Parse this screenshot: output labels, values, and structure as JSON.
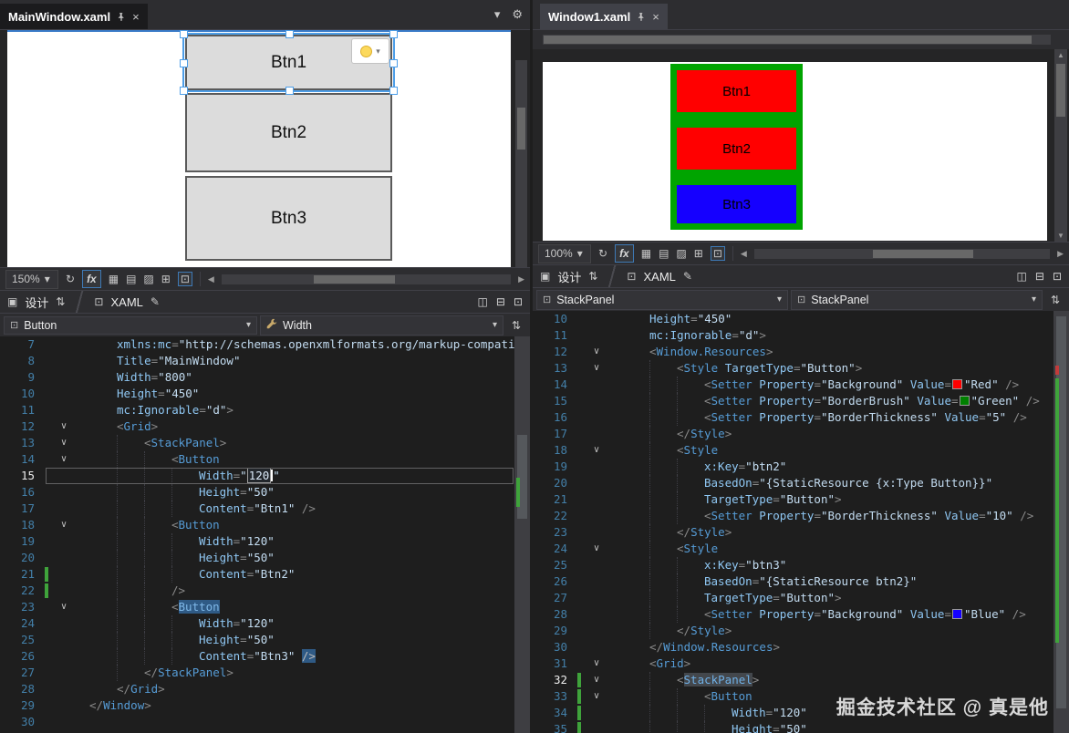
{
  "watermark": "掘金技术社区 @ 真是他",
  "icons": {
    "close": "×",
    "chevron": "▾",
    "gear": "⚙",
    "refresh": "↻",
    "left": "◀",
    "right": "▶",
    "up": "▲",
    "down": "▼",
    "swap": "⇅",
    "grid": "▦",
    "grid2": "▤",
    "snap": "▨",
    "guides": "⊞",
    "dock": "⊡",
    "design": "▣",
    "xamlsq": "⊡",
    "edit": "✎",
    "splitv": "◫",
    "splith": "⊟",
    "popout": "⊞"
  },
  "left": {
    "tab": "MainWindow.xaml",
    "zoom": "150%",
    "fx": "fx",
    "design_label": "设计",
    "xaml_label": "XAML",
    "crumb_element": "Button",
    "crumb_property": "Width",
    "designer_buttons": [
      {
        "label": "Btn1",
        "selected": true
      },
      {
        "label": "Btn2",
        "selected": false
      },
      {
        "label": "Btn3",
        "selected": false
      }
    ],
    "lines": [
      {
        "n": 7,
        "i": 4,
        "t": [
          [
            "a",
            "xmlns:mc"
          ],
          [
            "p",
            "="
          ],
          [
            "v",
            "\"http://schemas.openxmlformats.org/markup-compati"
          ]
        ]
      },
      {
        "n": 8,
        "i": 4,
        "t": [
          [
            "a",
            "Title"
          ],
          [
            "p",
            "="
          ],
          [
            "v",
            "\"MainWindow\""
          ]
        ]
      },
      {
        "n": 9,
        "i": 4,
        "t": [
          [
            "a",
            "Width"
          ],
          [
            "p",
            "="
          ],
          [
            "v",
            "\"800\""
          ]
        ]
      },
      {
        "n": 10,
        "i": 4,
        "t": [
          [
            "a",
            "Height"
          ],
          [
            "p",
            "="
          ],
          [
            "v",
            "\"450\""
          ]
        ]
      },
      {
        "n": 11,
        "i": 4,
        "t": [
          [
            "a",
            "mc:Ignorable"
          ],
          [
            "p",
            "="
          ],
          [
            "v",
            "\"d\""
          ],
          [
            "p",
            ">"
          ]
        ]
      },
      {
        "n": 12,
        "i": 4,
        "a": 1,
        "t": [
          [
            "p",
            "<"
          ],
          [
            "e",
            "Grid"
          ],
          [
            "p",
            ">"
          ]
        ]
      },
      {
        "n": 13,
        "i": 8,
        "a": 1,
        "t": [
          [
            "p",
            "<"
          ],
          [
            "e",
            "StackPanel"
          ],
          [
            "p",
            ">"
          ]
        ]
      },
      {
        "n": 14,
        "i": 12,
        "a": 1,
        "t": [
          [
            "p",
            "<"
          ],
          [
            "e",
            "Button"
          ]
        ]
      },
      {
        "n": 15,
        "i": 16,
        "cur": 1,
        "w": 1,
        "t": [
          [
            "a",
            "Width"
          ],
          [
            "p",
            "="
          ],
          [
            "v",
            "\""
          ],
          [
            "vs",
            "120"
          ],
          [
            "cr",
            ""
          ],
          [
            "v",
            "\""
          ]
        ]
      },
      {
        "n": 16,
        "i": 16,
        "t": [
          [
            "a",
            "Height"
          ],
          [
            "p",
            "="
          ],
          [
            "v",
            "\"50\""
          ]
        ]
      },
      {
        "n": 17,
        "i": 16,
        "t": [
          [
            "a",
            "Content"
          ],
          [
            "p",
            "="
          ],
          [
            "v",
            "\"Btn1\""
          ],
          [
            "p",
            " />"
          ]
        ]
      },
      {
        "n": 18,
        "i": 12,
        "a": 1,
        "t": [
          [
            "p",
            "<"
          ],
          [
            "e",
            "Button"
          ]
        ]
      },
      {
        "n": 19,
        "i": 16,
        "t": [
          [
            "a",
            "Width"
          ],
          [
            "p",
            "="
          ],
          [
            "v",
            "\"120\""
          ]
        ]
      },
      {
        "n": 20,
        "i": 16,
        "t": [
          [
            "a",
            "Height"
          ],
          [
            "p",
            "="
          ],
          [
            "v",
            "\"50\""
          ]
        ]
      },
      {
        "n": 21,
        "i": 16,
        "g": 1,
        "t": [
          [
            "a",
            "Content"
          ],
          [
            "p",
            "="
          ],
          [
            "v",
            "\"Btn2\""
          ]
        ]
      },
      {
        "n": 22,
        "i": 12,
        "g": 1,
        "t": [
          [
            "p",
            "/>"
          ]
        ]
      },
      {
        "n": 23,
        "i": 12,
        "a": 1,
        "t": [
          [
            "p",
            "<"
          ],
          [
            "eh",
            "Button"
          ]
        ]
      },
      {
        "n": 24,
        "i": 16,
        "t": [
          [
            "a",
            "Width"
          ],
          [
            "p",
            "="
          ],
          [
            "v",
            "\"120\""
          ]
        ]
      },
      {
        "n": 25,
        "i": 16,
        "t": [
          [
            "a",
            "Height"
          ],
          [
            "p",
            "="
          ],
          [
            "v",
            "\"50\""
          ]
        ]
      },
      {
        "n": 26,
        "i": 16,
        "t": [
          [
            "a",
            "Content"
          ],
          [
            "p",
            "="
          ],
          [
            "v",
            "\"Btn3\""
          ],
          [
            "p",
            " "
          ],
          [
            "ph",
            "/>"
          ]
        ]
      },
      {
        "n": 27,
        "i": 8,
        "t": [
          [
            "p",
            "</"
          ],
          [
            "e",
            "StackPanel"
          ],
          [
            "p",
            ">"
          ]
        ]
      },
      {
        "n": 28,
        "i": 4,
        "t": [
          [
            "p",
            "</"
          ],
          [
            "e",
            "Grid"
          ],
          [
            "p",
            ">"
          ]
        ]
      },
      {
        "n": 29,
        "i": 0,
        "t": [
          [
            "p",
            "</"
          ],
          [
            "e",
            "Window"
          ],
          [
            "p",
            ">"
          ]
        ]
      },
      {
        "n": 30,
        "i": 0,
        "t": []
      }
    ]
  },
  "right": {
    "tab": "Window1.xaml",
    "zoom": "100%",
    "fx": "fx",
    "design_label": "设计",
    "xaml_label": "XAML",
    "crumb_element": "StackPanel",
    "crumb_element2": "StackPanel",
    "panel": {
      "bg": "#00A400",
      "buttons": [
        {
          "label": "Btn1",
          "bg": "#FF0000"
        },
        {
          "label": "Btn2",
          "bg": "#FF0000"
        },
        {
          "label": "Btn3",
          "bg": "#1500FF"
        }
      ]
    },
    "lines": [
      {
        "n": 10,
        "i": 4,
        "t": [
          [
            "a",
            "Height"
          ],
          [
            "p",
            "="
          ],
          [
            "v",
            "\"450\""
          ]
        ]
      },
      {
        "n": 11,
        "i": 4,
        "t": [
          [
            "a",
            "mc:Ignorable"
          ],
          [
            "p",
            "="
          ],
          [
            "v",
            "\"d\""
          ],
          [
            "p",
            ">"
          ]
        ]
      },
      {
        "n": 12,
        "i": 4,
        "a": 1,
        "t": [
          [
            "p",
            "<"
          ],
          [
            "e",
            "Window.Resources"
          ],
          [
            "p",
            ">"
          ]
        ]
      },
      {
        "n": 13,
        "i": 8,
        "a": 1,
        "t": [
          [
            "p",
            "<"
          ],
          [
            "e",
            "Style"
          ],
          [
            "p",
            " "
          ],
          [
            "a",
            "TargetType"
          ],
          [
            "p",
            "="
          ],
          [
            "v",
            "\"Button\""
          ],
          [
            "p",
            ">"
          ]
        ]
      },
      {
        "n": 14,
        "i": 12,
        "t": [
          [
            "p",
            "<"
          ],
          [
            "e",
            "Setter"
          ],
          [
            "p",
            " "
          ],
          [
            "a",
            "Property"
          ],
          [
            "p",
            "="
          ],
          [
            "v",
            "\"Background\""
          ],
          [
            "p",
            " "
          ],
          [
            "a",
            "Value"
          ],
          [
            "p",
            "="
          ],
          [
            "sw",
            "#FF0000"
          ],
          [
            "v",
            "\"Red\""
          ],
          [
            "p",
            " />"
          ]
        ]
      },
      {
        "n": 15,
        "i": 12,
        "t": [
          [
            "p",
            "<"
          ],
          [
            "e",
            "Setter"
          ],
          [
            "p",
            " "
          ],
          [
            "a",
            "Property"
          ],
          [
            "p",
            "="
          ],
          [
            "v",
            "\"BorderBrush\""
          ],
          [
            "p",
            " "
          ],
          [
            "a",
            "Value"
          ],
          [
            "p",
            "="
          ],
          [
            "sw",
            "#008000"
          ],
          [
            "v",
            "\"Green\""
          ],
          [
            "p",
            " />"
          ]
        ]
      },
      {
        "n": 16,
        "i": 12,
        "t": [
          [
            "p",
            "<"
          ],
          [
            "e",
            "Setter"
          ],
          [
            "p",
            " "
          ],
          [
            "a",
            "Property"
          ],
          [
            "p",
            "="
          ],
          [
            "v",
            "\"BorderThickness\""
          ],
          [
            "p",
            " "
          ],
          [
            "a",
            "Value"
          ],
          [
            "p",
            "="
          ],
          [
            "v",
            "\"5\""
          ],
          [
            "p",
            " />"
          ]
        ]
      },
      {
        "n": 17,
        "i": 8,
        "t": [
          [
            "p",
            "</"
          ],
          [
            "e",
            "Style"
          ],
          [
            "p",
            ">"
          ]
        ]
      },
      {
        "n": 18,
        "i": 8,
        "a": 1,
        "t": [
          [
            "p",
            "<"
          ],
          [
            "e",
            "Style"
          ]
        ]
      },
      {
        "n": 19,
        "i": 12,
        "t": [
          [
            "a",
            "x:Key"
          ],
          [
            "p",
            "="
          ],
          [
            "v",
            "\"btn2\""
          ]
        ]
      },
      {
        "n": 20,
        "i": 12,
        "t": [
          [
            "a",
            "BasedOn"
          ],
          [
            "p",
            "="
          ],
          [
            "v",
            "\"{StaticResource {x:Type Button}}\""
          ]
        ]
      },
      {
        "n": 21,
        "i": 12,
        "t": [
          [
            "a",
            "TargetType"
          ],
          [
            "p",
            "="
          ],
          [
            "v",
            "\"Button\""
          ],
          [
            "p",
            ">"
          ]
        ]
      },
      {
        "n": 22,
        "i": 12,
        "t": [
          [
            "p",
            "<"
          ],
          [
            "e",
            "Setter"
          ],
          [
            "p",
            " "
          ],
          [
            "a",
            "Property"
          ],
          [
            "p",
            "="
          ],
          [
            "v",
            "\"BorderThickness\""
          ],
          [
            "p",
            " "
          ],
          [
            "a",
            "Value"
          ],
          [
            "p",
            "="
          ],
          [
            "v",
            "\"10\""
          ],
          [
            "p",
            " />"
          ]
        ]
      },
      {
        "n": 23,
        "i": 8,
        "t": [
          [
            "p",
            "</"
          ],
          [
            "e",
            "Style"
          ],
          [
            "p",
            ">"
          ]
        ]
      },
      {
        "n": 24,
        "i": 8,
        "a": 1,
        "t": [
          [
            "p",
            "<"
          ],
          [
            "e",
            "Style"
          ]
        ]
      },
      {
        "n": 25,
        "i": 12,
        "t": [
          [
            "a",
            "x:Key"
          ],
          [
            "p",
            "="
          ],
          [
            "v",
            "\"btn3\""
          ]
        ]
      },
      {
        "n": 26,
        "i": 12,
        "t": [
          [
            "a",
            "BasedOn"
          ],
          [
            "p",
            "="
          ],
          [
            "v",
            "\"{StaticResource btn2}\""
          ]
        ]
      },
      {
        "n": 27,
        "i": 12,
        "t": [
          [
            "a",
            "TargetType"
          ],
          [
            "p",
            "="
          ],
          [
            "v",
            "\"Button\""
          ],
          [
            "p",
            ">"
          ]
        ]
      },
      {
        "n": 28,
        "i": 12,
        "t": [
          [
            "p",
            "<"
          ],
          [
            "e",
            "Setter"
          ],
          [
            "p",
            " "
          ],
          [
            "a",
            "Property"
          ],
          [
            "p",
            "="
          ],
          [
            "v",
            "\"Background\""
          ],
          [
            "p",
            " "
          ],
          [
            "a",
            "Value"
          ],
          [
            "p",
            "="
          ],
          [
            "sw",
            "#1500FF"
          ],
          [
            "v",
            "\"Blue\""
          ],
          [
            "p",
            " />"
          ]
        ]
      },
      {
        "n": 29,
        "i": 8,
        "t": [
          [
            "p",
            "</"
          ],
          [
            "e",
            "Style"
          ],
          [
            "p",
            ">"
          ]
        ]
      },
      {
        "n": 30,
        "i": 4,
        "t": [
          [
            "p",
            "</"
          ],
          [
            "e",
            "Window.Resources"
          ],
          [
            "p",
            ">"
          ]
        ]
      },
      {
        "n": 31,
        "i": 4,
        "a": 1,
        "t": [
          [
            "p",
            "<"
          ],
          [
            "e",
            "Grid"
          ],
          [
            "p",
            ">"
          ]
        ]
      },
      {
        "n": 32,
        "i": 8,
        "a": 1,
        "g": 1,
        "w": 1,
        "t": [
          [
            "p",
            "<"
          ],
          [
            "eg",
            "StackPanel"
          ],
          [
            "p",
            ">"
          ]
        ]
      },
      {
        "n": 33,
        "i": 12,
        "a": 1,
        "g": 1,
        "t": [
          [
            "p",
            "<"
          ],
          [
            "e",
            "Button"
          ]
        ]
      },
      {
        "n": 34,
        "i": 16,
        "g": 1,
        "t": [
          [
            "a",
            "Width"
          ],
          [
            "p",
            "="
          ],
          [
            "v",
            "\"120\""
          ]
        ]
      },
      {
        "n": 35,
        "i": 16,
        "g": 1,
        "t": [
          [
            "a",
            "Height"
          ],
          [
            "p",
            "="
          ],
          [
            "v",
            "\"50\""
          ]
        ]
      }
    ]
  }
}
